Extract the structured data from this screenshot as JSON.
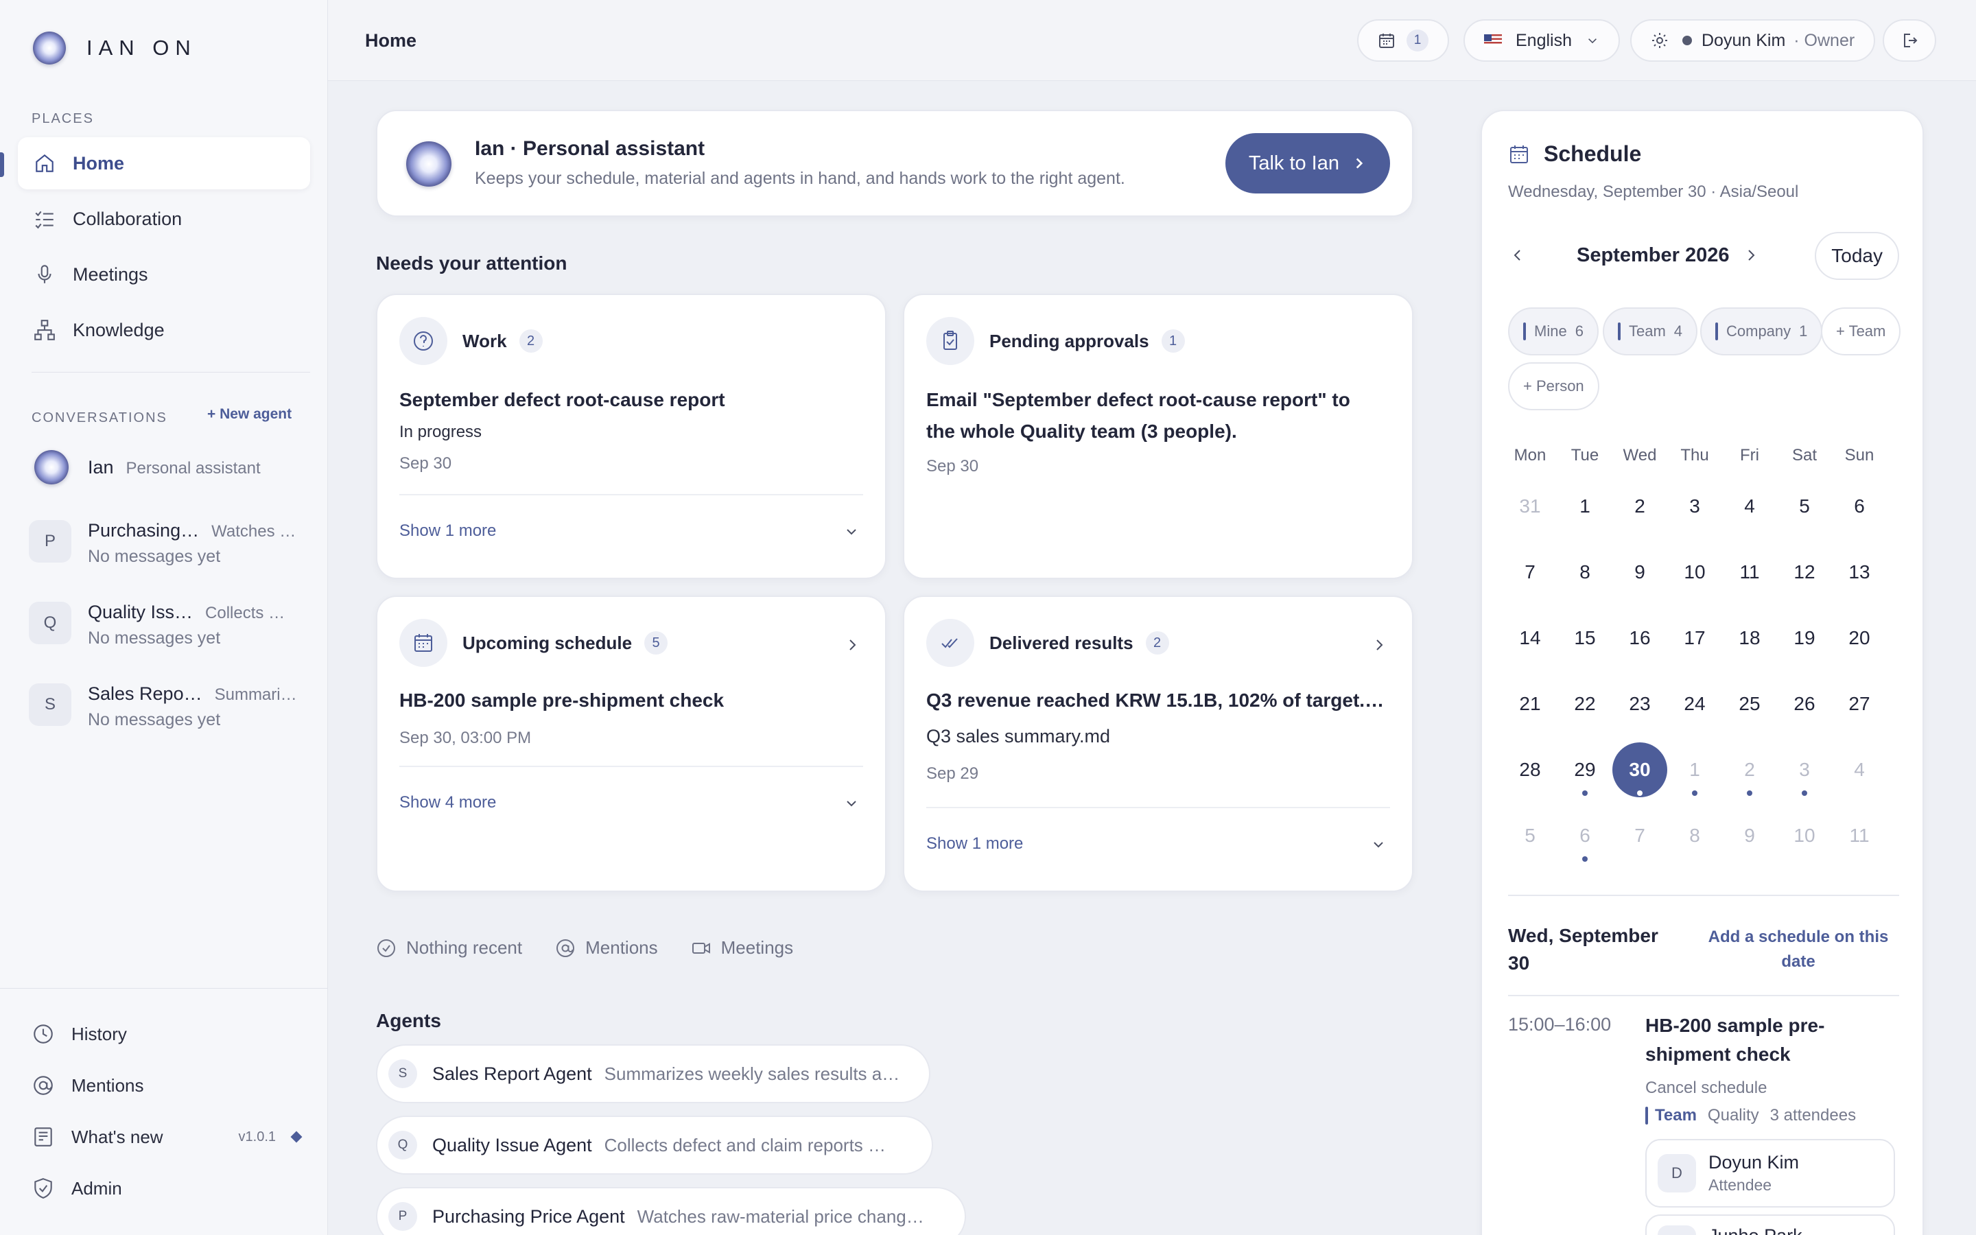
{
  "app": {
    "name": "IAN ON"
  },
  "sidebar": {
    "places_label": "PLACES",
    "nav": [
      {
        "label": "Home",
        "icon": "home-icon"
      },
      {
        "label": "Collaboration",
        "icon": "checklist-icon"
      },
      {
        "label": "Meetings",
        "icon": "microphone-icon"
      },
      {
        "label": "Knowledge",
        "icon": "hierarchy-icon"
      }
    ],
    "conversations_label": "CONVERSATIONS",
    "new_agent_label": "New agent",
    "conversations": [
      {
        "avatar": "",
        "name": "Ian",
        "desc": "Personal assistant",
        "sub": ""
      },
      {
        "avatar": "P",
        "name": "Purchasing…",
        "desc": "Watches …",
        "sub": "No messages yet"
      },
      {
        "avatar": "Q",
        "name": "Quality Iss…",
        "desc": "Collects …",
        "sub": "No messages yet"
      },
      {
        "avatar": "S",
        "name": "Sales Repo…",
        "desc": "Summari…",
        "sub": "No messages yet"
      }
    ],
    "bottom": [
      {
        "label": "History",
        "icon": "clock-icon"
      },
      {
        "label": "Mentions",
        "icon": "at-icon"
      },
      {
        "label": "What's new",
        "icon": "news-icon",
        "version": "v1.0.1"
      },
      {
        "label": "Admin",
        "icon": "shield-icon"
      }
    ]
  },
  "topbar": {
    "breadcrumb": "Home",
    "calendar_count": "1",
    "language": "English",
    "user_name": "Doyun Kim",
    "user_role": "· Owner"
  },
  "assistant": {
    "title": "Ian · Personal assistant",
    "subtitle": "Keeps your schedule, material and agents in hand, and hands work to the right agent.",
    "button": "Talk to Ian"
  },
  "attention": {
    "heading": "Needs your attention",
    "work": {
      "title": "Work",
      "count": "2",
      "item_title": "September defect root-cause report",
      "item_status": "In progress",
      "item_date": "Sep 30",
      "show_more": "Show 1 more"
    },
    "approvals": {
      "title": "Pending approvals",
      "count": "1",
      "item_title_1": "Email \"September defect root-cause report\" to",
      "item_title_2": "the whole Quality team (3 people).",
      "item_date": "Sep 30"
    },
    "schedule": {
      "title": "Upcoming schedule",
      "count": "5",
      "item_title": "HB-200 sample pre-shipment check",
      "item_date": "Sep 30, 03:00 PM",
      "show_more": "Show 4 more"
    },
    "results": {
      "title": "Delivered results",
      "count": "2",
      "item_title": "Q3 revenue reached KRW 15.1B, 102% of target.…",
      "item_file": "Q3 sales summary.md",
      "item_date": "Sep 29",
      "show_more": "Show 1 more"
    }
  },
  "filters": [
    {
      "label": "Nothing recent",
      "icon": "check-circle-icon"
    },
    {
      "label": "Mentions",
      "icon": "at-icon"
    },
    {
      "label": "Meetings",
      "icon": "video-icon"
    }
  ],
  "agents": {
    "heading": "Agents",
    "items": [
      {
        "letter": "S",
        "name": "Sales Report Agent",
        "desc": "Summarizes weekly sales results a…"
      },
      {
        "letter": "Q",
        "name": "Quality Issue Agent",
        "desc": "Collects defect and claim reports …"
      },
      {
        "letter": "P",
        "name": "Purchasing Price Agent",
        "desc": "Watches raw-material price chang…"
      }
    ]
  },
  "schedule": {
    "title": "Schedule",
    "subtitle": "Wednesday, September 30 · Asia/Seoul",
    "month": "September 2026",
    "today_button": "Today",
    "chips": [
      {
        "label": "Mine",
        "count": "6",
        "bar": true
      },
      {
        "label": "Team",
        "count": "4",
        "bar": true
      },
      {
        "label": "Company",
        "count": "1",
        "bar": true
      },
      {
        "label": "+ Team",
        "count": "",
        "bar": false
      },
      {
        "label": "+ Person",
        "count": "",
        "bar": false
      }
    ],
    "weekdays": [
      "Mon",
      "Tue",
      "Wed",
      "Thu",
      "Fri",
      "Sat",
      "Sun"
    ],
    "days": [
      [
        "31",
        "1",
        "2",
        "3",
        "4",
        "5",
        "6"
      ],
      [
        "7",
        "8",
        "9",
        "10",
        "11",
        "12",
        "13"
      ],
      [
        "14",
        "15",
        "16",
        "17",
        "18",
        "19",
        "20"
      ],
      [
        "21",
        "22",
        "23",
        "24",
        "25",
        "26",
        "27"
      ],
      [
        "28",
        "29",
        "30",
        "1",
        "2",
        "3",
        "4"
      ],
      [
        "5",
        "6",
        "7",
        "8",
        "9",
        "10",
        "11"
      ]
    ],
    "selected_day": "30",
    "selected_date": "Wed, September 30",
    "add_label": "Add a schedule on this date",
    "event": {
      "time": "15:00–16:00",
      "title": "HB-200 sample pre-shipment check",
      "cancel": "Cancel schedule",
      "scope": "Team",
      "group": "Quality",
      "attendees_count": "3 attendees",
      "attendees": [
        {
          "letter": "D",
          "name": "Doyun Kim",
          "role": "Attendee"
        },
        {
          "letter": "",
          "name": "Junho Park",
          "role": ""
        }
      ]
    }
  },
  "colors": {
    "accent": "#4d5d99",
    "background": "#eef0f5"
  }
}
